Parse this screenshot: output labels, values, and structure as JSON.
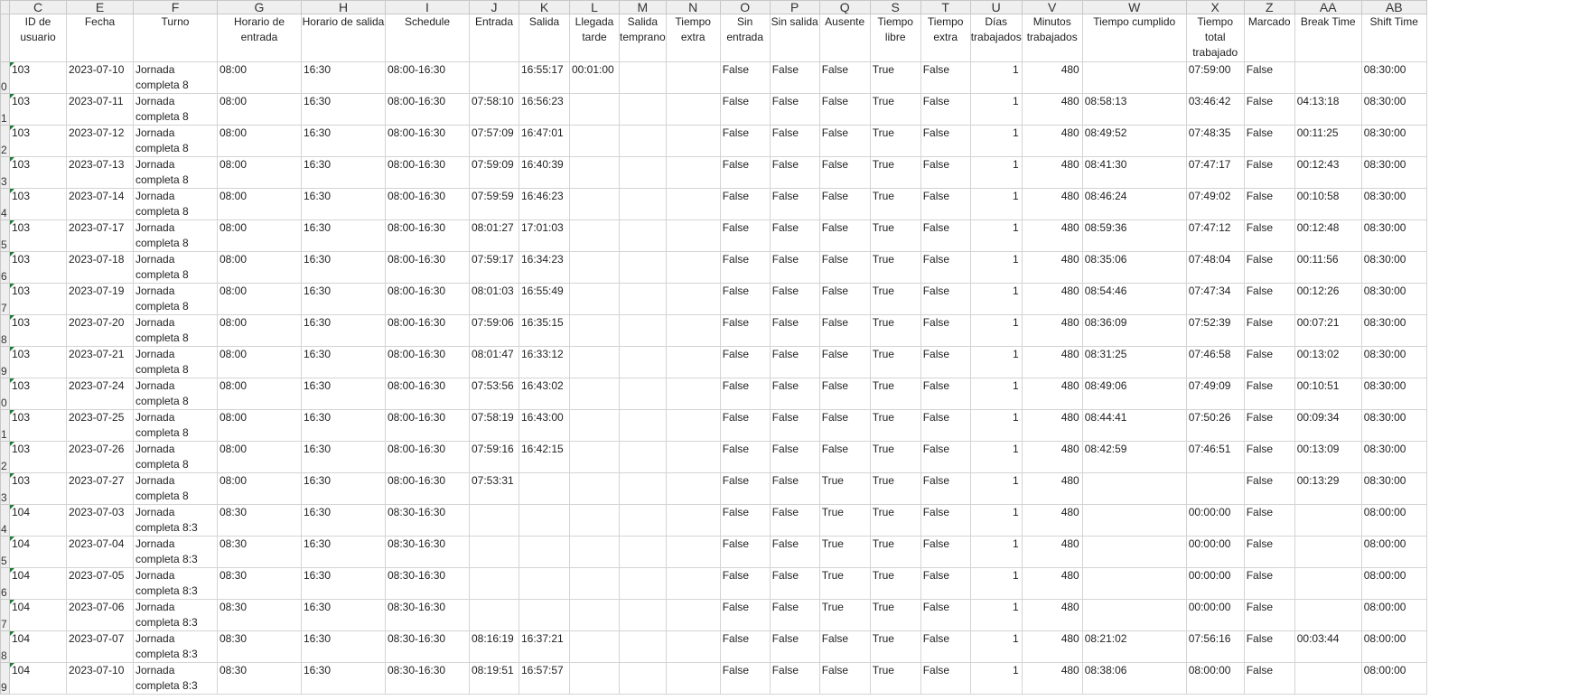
{
  "column_letters": [
    "C",
    "E",
    "F",
    "G",
    "H",
    "I",
    "J",
    "K",
    "L",
    "M",
    "N",
    "O",
    "P",
    "Q",
    "S",
    "T",
    "U",
    "V",
    "W",
    "X",
    "Z",
    "AA",
    "AB"
  ],
  "headers": [
    "ID de usuario",
    "Fecha",
    "Turno",
    "Horario de entrada",
    "Horario de salida",
    "Schedule",
    "Entrada",
    "Salida",
    "Llegada tarde",
    "Salida temprano",
    "Tiempo extra",
    "Sin entrada",
    "Sin salida",
    "Ausente",
    "Tiempo libre",
    "Tiempo extra",
    "Días trabajados",
    "Minutos trabajados",
    "Tiempo cumplido",
    "Tiempo total trabajado",
    "Marcado",
    "Break Time",
    "Shift Time"
  ],
  "row_numbers": [
    "0",
    "1",
    "2",
    "3",
    "4",
    "5",
    "6",
    "7",
    "8",
    "9",
    "0",
    "1",
    "2",
    "3",
    "4",
    "5",
    "6",
    "7",
    "8",
    "9"
  ],
  "rows": [
    [
      "103",
      "2023-07-10",
      "Jornada completa 8",
      "08:00",
      "16:30",
      "08:00-16:30",
      "",
      "16:55:17",
      "00:01:00",
      "",
      "",
      "False",
      "False",
      "False",
      "True",
      "False",
      "1",
      "480",
      "",
      "07:59:00",
      "False",
      "",
      "08:30:00"
    ],
    [
      "103",
      "2023-07-11",
      "Jornada completa 8",
      "08:00",
      "16:30",
      "08:00-16:30",
      "07:58:10",
      "16:56:23",
      "",
      "",
      "",
      "False",
      "False",
      "False",
      "True",
      "False",
      "1",
      "480",
      "08:58:13",
      "03:46:42",
      "False",
      "04:13:18",
      "08:30:00"
    ],
    [
      "103",
      "2023-07-12",
      "Jornada completa 8",
      "08:00",
      "16:30",
      "08:00-16:30",
      "07:57:09",
      "16:47:01",
      "",
      "",
      "",
      "False",
      "False",
      "False",
      "True",
      "False",
      "1",
      "480",
      "08:49:52",
      "07:48:35",
      "False",
      "00:11:25",
      "08:30:00"
    ],
    [
      "103",
      "2023-07-13",
      "Jornada completa 8",
      "08:00",
      "16:30",
      "08:00-16:30",
      "07:59:09",
      "16:40:39",
      "",
      "",
      "",
      "False",
      "False",
      "False",
      "True",
      "False",
      "1",
      "480",
      "08:41:30",
      "07:47:17",
      "False",
      "00:12:43",
      "08:30:00"
    ],
    [
      "103",
      "2023-07-14",
      "Jornada completa 8",
      "08:00",
      "16:30",
      "08:00-16:30",
      "07:59:59",
      "16:46:23",
      "",
      "",
      "",
      "False",
      "False",
      "False",
      "True",
      "False",
      "1",
      "480",
      "08:46:24",
      "07:49:02",
      "False",
      "00:10:58",
      "08:30:00"
    ],
    [
      "103",
      "2023-07-17",
      "Jornada completa 8",
      "08:00",
      "16:30",
      "08:00-16:30",
      "08:01:27",
      "17:01:03",
      "",
      "",
      "",
      "False",
      "False",
      "False",
      "True",
      "False",
      "1",
      "480",
      "08:59:36",
      "07:47:12",
      "False",
      "00:12:48",
      "08:30:00"
    ],
    [
      "103",
      "2023-07-18",
      "Jornada completa 8",
      "08:00",
      "16:30",
      "08:00-16:30",
      "07:59:17",
      "16:34:23",
      "",
      "",
      "",
      "False",
      "False",
      "False",
      "True",
      "False",
      "1",
      "480",
      "08:35:06",
      "07:48:04",
      "False",
      "00:11:56",
      "08:30:00"
    ],
    [
      "103",
      "2023-07-19",
      "Jornada completa 8",
      "08:00",
      "16:30",
      "08:00-16:30",
      "08:01:03",
      "16:55:49",
      "",
      "",
      "",
      "False",
      "False",
      "False",
      "True",
      "False",
      "1",
      "480",
      "08:54:46",
      "07:47:34",
      "False",
      "00:12:26",
      "08:30:00"
    ],
    [
      "103",
      "2023-07-20",
      "Jornada completa 8",
      "08:00",
      "16:30",
      "08:00-16:30",
      "07:59:06",
      "16:35:15",
      "",
      "",
      "",
      "False",
      "False",
      "False",
      "True",
      "False",
      "1",
      "480",
      "08:36:09",
      "07:52:39",
      "False",
      "00:07:21",
      "08:30:00"
    ],
    [
      "103",
      "2023-07-21",
      "Jornada completa 8",
      "08:00",
      "16:30",
      "08:00-16:30",
      "08:01:47",
      "16:33:12",
      "",
      "",
      "",
      "False",
      "False",
      "False",
      "True",
      "False",
      "1",
      "480",
      "08:31:25",
      "07:46:58",
      "False",
      "00:13:02",
      "08:30:00"
    ],
    [
      "103",
      "2023-07-24",
      "Jornada completa 8",
      "08:00",
      "16:30",
      "08:00-16:30",
      "07:53:56",
      "16:43:02",
      "",
      "",
      "",
      "False",
      "False",
      "False",
      "True",
      "False",
      "1",
      "480",
      "08:49:06",
      "07:49:09",
      "False",
      "00:10:51",
      "08:30:00"
    ],
    [
      "103",
      "2023-07-25",
      "Jornada completa 8",
      "08:00",
      "16:30",
      "08:00-16:30",
      "07:58:19",
      "16:43:00",
      "",
      "",
      "",
      "False",
      "False",
      "False",
      "True",
      "False",
      "1",
      "480",
      "08:44:41",
      "07:50:26",
      "False",
      "00:09:34",
      "08:30:00"
    ],
    [
      "103",
      "2023-07-26",
      "Jornada completa 8",
      "08:00",
      "16:30",
      "08:00-16:30",
      "07:59:16",
      "16:42:15",
      "",
      "",
      "",
      "False",
      "False",
      "False",
      "True",
      "False",
      "1",
      "480",
      "08:42:59",
      "07:46:51",
      "False",
      "00:13:09",
      "08:30:00"
    ],
    [
      "103",
      "2023-07-27",
      "Jornada completa 8",
      "08:00",
      "16:30",
      "08:00-16:30",
      "07:53:31",
      "",
      "",
      "",
      "",
      "False",
      "False",
      "True",
      "True",
      "False",
      "1",
      "480",
      "",
      "",
      "False",
      "00:13:29",
      "08:30:00"
    ],
    [
      "104",
      "2023-07-03",
      "Jornada completa 8:3",
      "08:30",
      "16:30",
      "08:30-16:30",
      "",
      "",
      "",
      "",
      "",
      "False",
      "False",
      "True",
      "True",
      "False",
      "1",
      "480",
      "",
      "00:00:00",
      "False",
      "",
      "08:00:00"
    ],
    [
      "104",
      "2023-07-04",
      "Jornada completa 8:3",
      "08:30",
      "16:30",
      "08:30-16:30",
      "",
      "",
      "",
      "",
      "",
      "False",
      "False",
      "True",
      "True",
      "False",
      "1",
      "480",
      "",
      "00:00:00",
      "False",
      "",
      "08:00:00"
    ],
    [
      "104",
      "2023-07-05",
      "Jornada completa 8:3",
      "08:30",
      "16:30",
      "08:30-16:30",
      "",
      "",
      "",
      "",
      "",
      "False",
      "False",
      "True",
      "True",
      "False",
      "1",
      "480",
      "",
      "00:00:00",
      "False",
      "",
      "08:00:00"
    ],
    [
      "104",
      "2023-07-06",
      "Jornada completa 8:3",
      "08:30",
      "16:30",
      "08:30-16:30",
      "",
      "",
      "",
      "",
      "",
      "False",
      "False",
      "True",
      "True",
      "False",
      "1",
      "480",
      "",
      "00:00:00",
      "False",
      "",
      "08:00:00"
    ],
    [
      "104",
      "2023-07-07",
      "Jornada completa 8:3",
      "08:30",
      "16:30",
      "08:30-16:30",
      "08:16:19",
      "16:37:21",
      "",
      "",
      "",
      "False",
      "False",
      "False",
      "True",
      "False",
      "1",
      "480",
      "08:21:02",
      "07:56:16",
      "False",
      "00:03:44",
      "08:00:00"
    ],
    [
      "104",
      "2023-07-10",
      "Jornada completa 8:3",
      "08:30",
      "16:30",
      "08:30-16:30",
      "08:19:51",
      "16:57:57",
      "",
      "",
      "",
      "False",
      "False",
      "False",
      "True",
      "False",
      "1",
      "480",
      "08:38:06",
      "08:00:00",
      "False",
      "",
      "08:00:00"
    ]
  ]
}
